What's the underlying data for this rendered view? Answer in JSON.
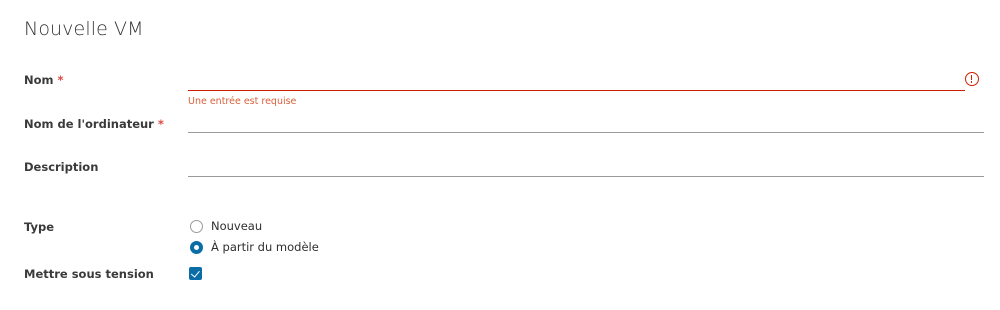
{
  "form": {
    "title": "Nouvelle VM",
    "required_marker": "*",
    "name": {
      "label": "Nom",
      "value": "",
      "error": "Une entrée est requise"
    },
    "computer_name": {
      "label": "Nom de l'ordinateur",
      "value": ""
    },
    "description": {
      "label": "Description",
      "value": ""
    },
    "type": {
      "label": "Type",
      "options": [
        "Nouveau",
        "À partir du modèle"
      ],
      "selected": "À partir du modèle"
    },
    "power_on": {
      "label": "Mettre sous tension",
      "checked": true
    }
  },
  "colors": {
    "accent": "#0b6da6",
    "error": "#c92100",
    "required": "#e0473f"
  },
  "icons": {
    "error": "exclamation-circle-icon",
    "checkbox": "checkmark-icon"
  }
}
